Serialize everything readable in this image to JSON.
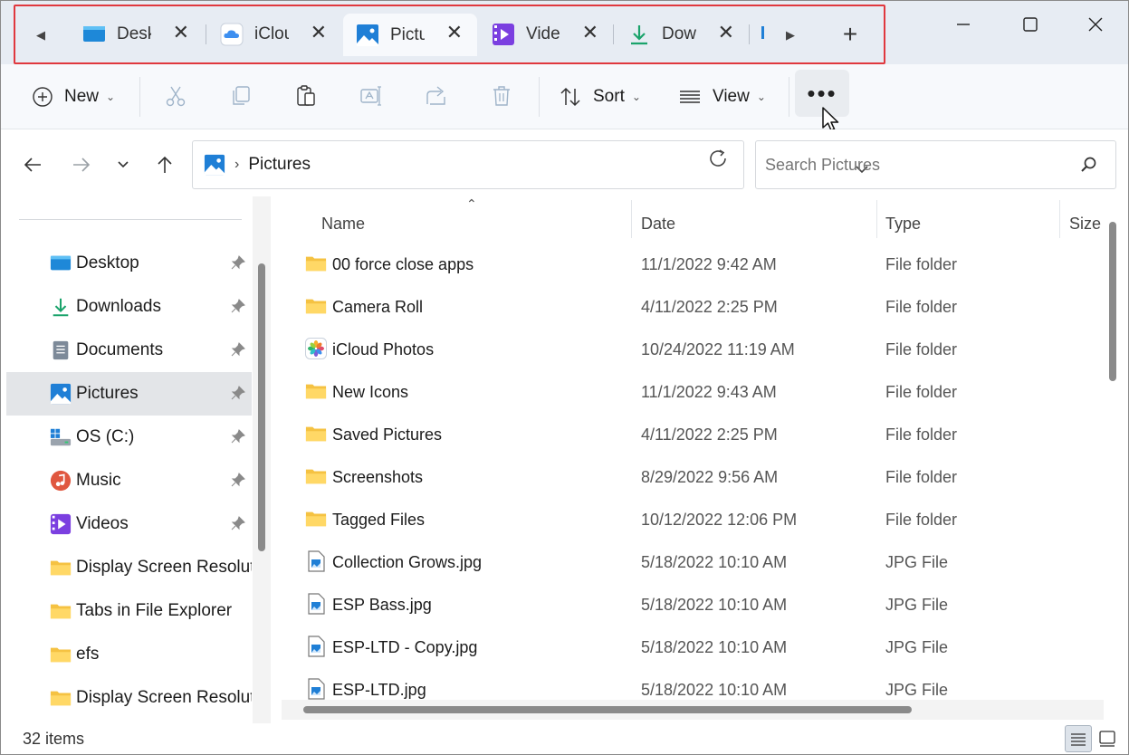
{
  "tabs": [
    {
      "label": "Deskt",
      "icon": "desktop-icon",
      "active": false
    },
    {
      "label": "iCloud",
      "icon": "icloud-icon",
      "active": false
    },
    {
      "label": "Pictur",
      "icon": "pictures-icon",
      "active": true
    },
    {
      "label": "Video",
      "icon": "videos-icon",
      "active": false
    },
    {
      "label": "Down",
      "icon": "downloads-icon",
      "active": false
    }
  ],
  "toolbar": {
    "new_label": "New",
    "sort_label": "Sort",
    "view_label": "View",
    "more_label": "•••"
  },
  "address": {
    "location": "Pictures"
  },
  "search": {
    "placeholder": "Search Pictures"
  },
  "sidebar": {
    "items": [
      {
        "label": "Desktop",
        "icon": "desktop-icon",
        "pinned": true
      },
      {
        "label": "Downloads",
        "icon": "downloads-icon",
        "pinned": true
      },
      {
        "label": "Documents",
        "icon": "documents-icon",
        "pinned": true
      },
      {
        "label": "Pictures",
        "icon": "pictures-icon",
        "pinned": true,
        "selected": true
      },
      {
        "label": "OS (C:)",
        "icon": "drive-icon",
        "pinned": true
      },
      {
        "label": "Music",
        "icon": "music-icon",
        "pinned": true
      },
      {
        "label": "Videos",
        "icon": "videos-icon",
        "pinned": true
      },
      {
        "label": "Display Screen Resolution",
        "icon": "folder-icon",
        "pinned": false
      },
      {
        "label": "Tabs in File Explorer",
        "icon": "folder-icon",
        "pinned": false
      },
      {
        "label": "efs",
        "icon": "folder-icon",
        "pinned": false
      },
      {
        "label": "Display Screen Resolution",
        "icon": "folder-icon",
        "pinned": false
      }
    ]
  },
  "columns": {
    "name": "Name",
    "date": "Date",
    "type": "Type",
    "size": "Size"
  },
  "files": [
    {
      "name": "00 force close apps",
      "date": "11/1/2022 9:42 AM",
      "type": "File folder",
      "icon": "folder-icon"
    },
    {
      "name": "Camera Roll",
      "date": "4/11/2022 2:25 PM",
      "type": "File folder",
      "icon": "folder-icon"
    },
    {
      "name": "iCloud Photos",
      "date": "10/24/2022 11:19 AM",
      "type": "File folder",
      "icon": "icloud-photos-icon"
    },
    {
      "name": "New Icons",
      "date": "11/1/2022 9:43 AM",
      "type": "File folder",
      "icon": "folder-icon"
    },
    {
      "name": "Saved Pictures",
      "date": "4/11/2022 2:25 PM",
      "type": "File folder",
      "icon": "folder-icon"
    },
    {
      "name": "Screenshots",
      "date": "8/29/2022 9:56 AM",
      "type": "File folder",
      "icon": "folder-icon"
    },
    {
      "name": "Tagged Files",
      "date": "10/12/2022 12:06 PM",
      "type": "File folder",
      "icon": "folder-icon"
    },
    {
      "name": "Collection Grows.jpg",
      "date": "5/18/2022 10:10 AM",
      "type": "JPG File",
      "icon": "image-file-icon"
    },
    {
      "name": "ESP Bass.jpg",
      "date": "5/18/2022 10:10 AM",
      "type": "JPG File",
      "icon": "image-file-icon"
    },
    {
      "name": "ESP-LTD - Copy.jpg",
      "date": "5/18/2022 10:10 AM",
      "type": "JPG File",
      "icon": "image-file-icon"
    },
    {
      "name": "ESP-LTD.jpg",
      "date": "5/18/2022 10:10 AM",
      "type": "JPG File",
      "icon": "image-file-icon"
    }
  ],
  "status": {
    "item_count": "32 items"
  },
  "colors": {
    "tab_bar": "#e7ecf3",
    "highlight_box": "#e0383e",
    "folder_yellow": "#f5c242",
    "accent_blue": "#0f6cbd"
  }
}
